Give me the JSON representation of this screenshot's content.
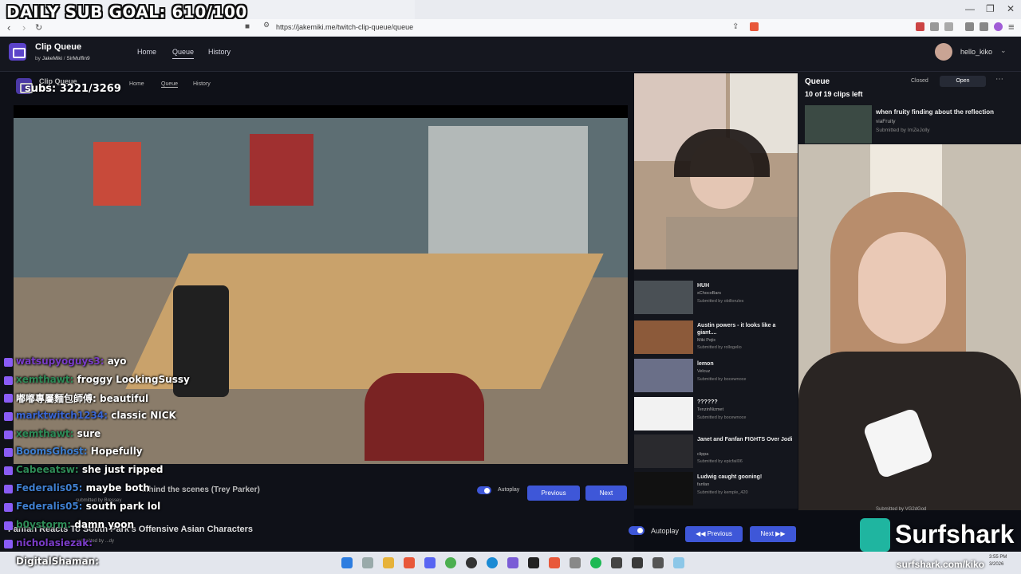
{
  "overlay": {
    "sub_goal": "DAILY SUB GOAL: 610/100",
    "subs_counter": "subs: 3221/3269",
    "sponsor": "Surfshark",
    "sponsor_url": "surfshark.com/kiko",
    "last_follower": "DigitalShaman:"
  },
  "browser": {
    "url": "https://jakemiki.me/twitch-clip-queue/queue",
    "window_controls": [
      "—",
      "❐",
      "✕"
    ]
  },
  "app": {
    "title": "Clip Queue",
    "by_label": "by",
    "author1": "JakeMiki",
    "sep": "/",
    "author2": "SirMuffin9",
    "nav": [
      "Home",
      "Queue",
      "History"
    ],
    "user": "hello_kiko"
  },
  "inner_app": {
    "title": "Clip Queue",
    "nav": [
      "Home",
      "Queue",
      "History"
    ]
  },
  "player": {
    "clip_title_back": "...hind the scenes (Trey Parker)",
    "submitted_back": "submitted by Bressey",
    "autoplay_label": "Autoplay",
    "previous_label": "Previous",
    "next_label": "Next",
    "current_title": "Fanfan Reacts To South Park's Offensive Asian Characters",
    "current_meta": "submitted by ...dy"
  },
  "chat": [
    {
      "user": "watsupyoguys3:",
      "msg": "ayo",
      "color": "#7a3cc8"
    },
    {
      "user": "xemthawt:",
      "msg": "froggy LookingSussy",
      "color": "#2e8b57"
    },
    {
      "user": "嘟嘟專屬麵包師傅:",
      "msg": "beautiful",
      "color": "#ffffff"
    },
    {
      "user": "marktwitch1234:",
      "msg": "classic NICK",
      "color": "#3a66d4"
    },
    {
      "user": "xemthawt:",
      "msg": "sure",
      "color": "#2e8b57"
    },
    {
      "user": "BoomsGhost:",
      "msg": "Hopefully",
      "color": "#3f7fd0"
    },
    {
      "user": "Cabeeatsw:",
      "msg": "she just ripped",
      "color": "#2e8b57"
    },
    {
      "user": "Federalis05:",
      "msg": "maybe both",
      "color": "#3f7fd0"
    },
    {
      "user": "Federalis05:",
      "msg": "south park lol",
      "color": "#3f7fd0"
    },
    {
      "user": "b0ystorm:",
      "msg": "damn yoon",
      "color": "#2e8b57"
    },
    {
      "user": "nicholasiezak:",
      "msg": "",
      "color": "#7a3cc8"
    }
  ],
  "queue": {
    "heading": "Queue",
    "closed_label": "Closed",
    "open_label": "Open",
    "more_label": "⋯",
    "count": "10 of 19 clips left",
    "items": [
      {
        "title": "when fruity finding about the reflection",
        "channel": "viaFruity",
        "submitted": "Submitted by ImZeJolly"
      },
      {
        "title": "HUH",
        "channel": "xChocoBars",
        "submitted": "Submitted by obillorules"
      },
      {
        "title": "Austin powers - it looks like a giant....",
        "channel": "Miki Pejic",
        "submitted": "Submitted by rollogelio"
      },
      {
        "title": "lemon",
        "channel": "Velcuz",
        "submitted": "Submitted by bocewnoce"
      },
      {
        "title": "??????",
        "channel": "TenzinNizmet",
        "submitted": "Submitted by bocewnoce"
      },
      {
        "title": "Janet and Fanfan FIGHTS Over Jodi",
        "channel": "clippa",
        "submitted": "Submitted by epicfail06"
      },
      {
        "title": "Ludwig caught gooning!",
        "channel": "fanfan",
        "submitted": "Submitted by kemple_420"
      }
    ],
    "extra_submitted": "Submitted by VG2dGod"
  },
  "taskbar": {
    "time": "3:55 PM",
    "date": "3/2026"
  },
  "colors": {
    "accent": "#3e57d8",
    "logo": "#5b43c9",
    "panel": "#14161d"
  }
}
